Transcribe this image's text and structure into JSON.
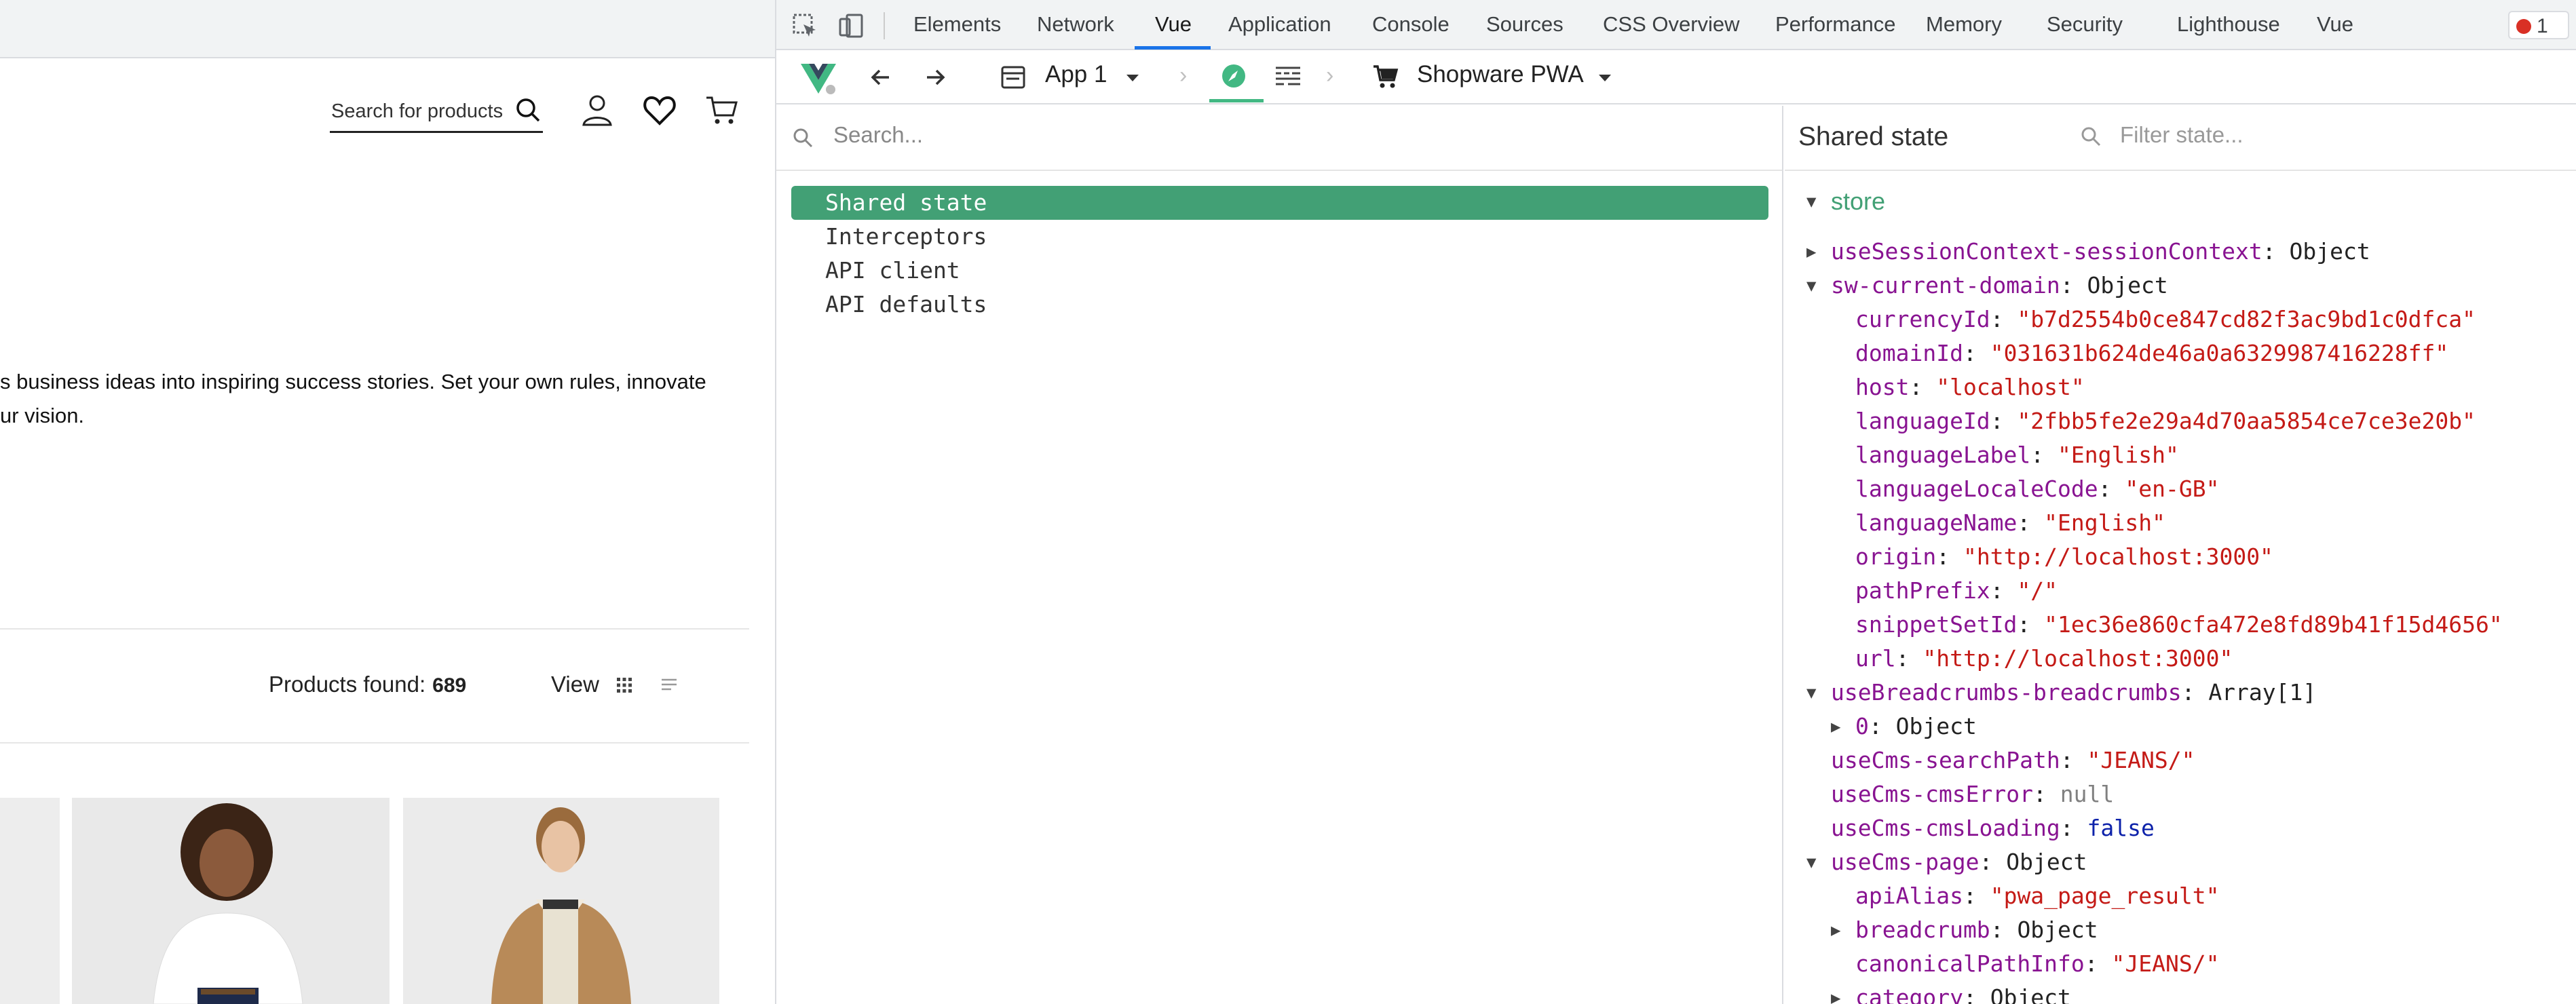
{
  "site": {
    "search_placeholder": "Search for products",
    "intro_line1": "s business ideas into inspiring success stories. Set your own rules, innovate",
    "intro_line2": "ur vision.",
    "products_found_label": "Products found:",
    "products_found_count": "689",
    "view_label": "View"
  },
  "devtools": {
    "tabs": [
      "Elements",
      "Network",
      "Vue",
      "Application",
      "Console",
      "Sources",
      "CSS Overview",
      "Performance",
      "Memory",
      "Security",
      "Lighthouse",
      "Vue"
    ],
    "active_tab": "Vue",
    "error_count": "1",
    "vue_toolbar": {
      "app_label": "App 1",
      "store_label": "Shopware PWA"
    },
    "left_search_placeholder": "Search...",
    "left_list": [
      "Shared state",
      "Interceptors",
      "API client",
      "API defaults"
    ],
    "selected_item": "Shared state",
    "right_title": "Shared state",
    "filter_placeholder": "Filter state...",
    "store_label": "store",
    "state_rows": [
      {
        "key": "useSessionContext-sessionContext",
        "value": "Object",
        "type": "obj",
        "expand": "collapsed",
        "indent": 1
      },
      {
        "key": "sw-current-domain",
        "value": "Object",
        "type": "obj",
        "expand": "expanded",
        "indent": 1
      },
      {
        "key": "currencyId",
        "value": "\"b7d2554b0ce847cd82f3ac9bd1c0dfca\"",
        "type": "str",
        "expand": "none",
        "indent": 2
      },
      {
        "key": "domainId",
        "value": "\"031631b624de46a0a6329987416228ff\"",
        "type": "str",
        "expand": "none",
        "indent": 2
      },
      {
        "key": "host",
        "value": "\"localhost\"",
        "type": "str",
        "expand": "none",
        "indent": 2
      },
      {
        "key": "languageId",
        "value": "\"2fbb5fe2e29a4d70aa5854ce7ce3e20b\"",
        "type": "str",
        "expand": "none",
        "indent": 2
      },
      {
        "key": "languageLabel",
        "value": "\"English\"",
        "type": "str",
        "expand": "none",
        "indent": 2
      },
      {
        "key": "languageLocaleCode",
        "value": "\"en-GB\"",
        "type": "str",
        "expand": "none",
        "indent": 2
      },
      {
        "key": "languageName",
        "value": "\"English\"",
        "type": "str",
        "expand": "none",
        "indent": 2
      },
      {
        "key": "origin",
        "value": "\"http://localhost:3000\"",
        "type": "str",
        "expand": "none",
        "indent": 2
      },
      {
        "key": "pathPrefix",
        "value": "\"/\"",
        "type": "str",
        "expand": "none",
        "indent": 2
      },
      {
        "key": "snippetSetId",
        "value": "\"1ec36e860cfa472e8fd89b41f15d4656\"",
        "type": "str",
        "expand": "none",
        "indent": 2
      },
      {
        "key": "url",
        "value": "\"http://localhost:3000\"",
        "type": "str",
        "expand": "none",
        "indent": 2
      },
      {
        "key": "useBreadcrumbs-breadcrumbs",
        "value": "Array[1]",
        "type": "obj",
        "expand": "expanded",
        "indent": 1
      },
      {
        "key": "0",
        "value": "Object",
        "type": "obj",
        "expand": "collapsed",
        "indent": 2
      },
      {
        "key": "useCms-searchPath",
        "value": "\"JEANS/\"",
        "type": "str",
        "expand": "none",
        "indent": 1
      },
      {
        "key": "useCms-cmsError",
        "value": "null",
        "type": "null",
        "expand": "none",
        "indent": 1
      },
      {
        "key": "useCms-cmsLoading",
        "value": "false",
        "type": "bool",
        "expand": "none",
        "indent": 1
      },
      {
        "key": "useCms-page",
        "value": "Object",
        "type": "obj",
        "expand": "expanded",
        "indent": 1
      },
      {
        "key": "apiAlias",
        "value": "\"pwa_page_result\"",
        "type": "str",
        "expand": "none",
        "indent": 2
      },
      {
        "key": "breadcrumb",
        "value": "Object",
        "type": "obj",
        "expand": "collapsed",
        "indent": 2
      },
      {
        "key": "canonicalPathInfo",
        "value": "\"JEANS/\"",
        "type": "str",
        "expand": "none",
        "indent": 2
      },
      {
        "key": "category",
        "value": "Object",
        "type": "obj",
        "expand": "collapsed",
        "indent": 2
      }
    ]
  }
}
